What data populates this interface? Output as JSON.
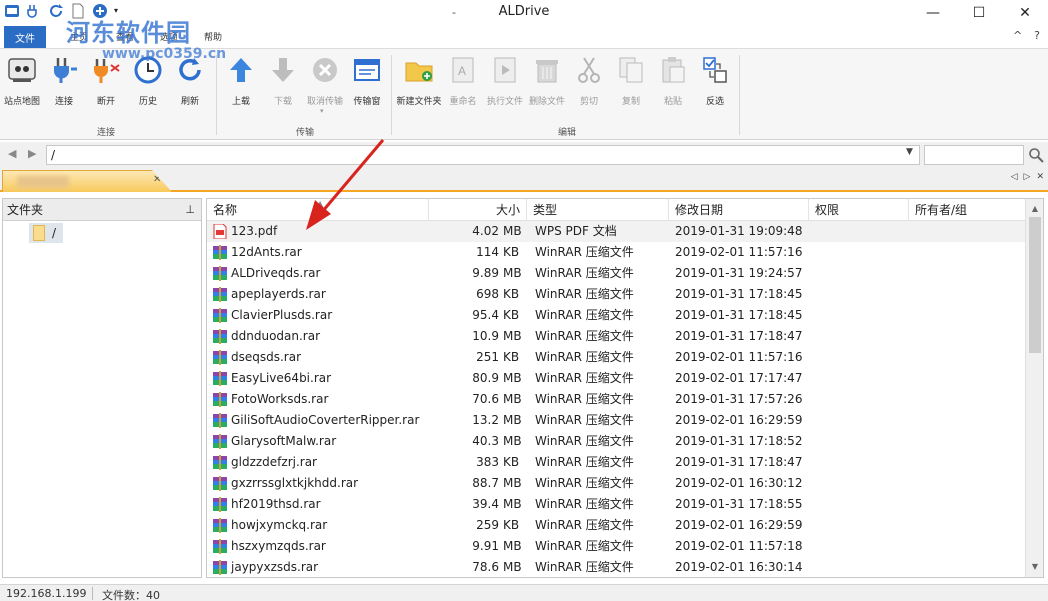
{
  "window": {
    "title": "ALDrive",
    "title_dash": "-",
    "minimize_glyph": "—",
    "maximize_glyph": "☐",
    "close_glyph": "✕"
  },
  "watermark": {
    "text": "河东软件园",
    "url": "www.pc0359.cn"
  },
  "menu": {
    "file_tab": "文件",
    "tabs": [
      "主页",
      "查看",
      "选项",
      "帮助"
    ],
    "help_glyph": "?",
    "collapse_glyph": "^"
  },
  "ribbon": {
    "groups": [
      {
        "label": "连接",
        "buttons": [
          {
            "label": "站点地图",
            "icon": "sitemap-icon",
            "enabled": true
          },
          {
            "label": "连接",
            "icon": "plug-icon",
            "enabled": true
          },
          {
            "label": "断开",
            "icon": "unplug-icon",
            "enabled": true
          },
          {
            "label": "历史",
            "icon": "clock-icon",
            "enabled": true
          },
          {
            "label": "刷新",
            "icon": "refresh-icon",
            "enabled": true
          }
        ]
      },
      {
        "label": "传输",
        "buttons": [
          {
            "label": "上载",
            "icon": "upload-icon",
            "enabled": true
          },
          {
            "label": "下载",
            "icon": "download-icon",
            "enabled": false
          },
          {
            "label": "取消传输",
            "icon": "cancel-icon",
            "enabled": false
          },
          {
            "label": "传输窗",
            "icon": "transfer-window-icon",
            "enabled": true
          }
        ]
      },
      {
        "label": "编辑",
        "buttons": [
          {
            "label": "新建文件夹",
            "icon": "new-folder-icon",
            "enabled": true
          },
          {
            "label": "重命名",
            "icon": "rename-icon",
            "enabled": false
          },
          {
            "label": "执行文件",
            "icon": "execute-icon",
            "enabled": false
          },
          {
            "label": "删除文件",
            "icon": "delete-icon",
            "enabled": false
          },
          {
            "label": "剪切",
            "icon": "cut-icon",
            "enabled": false
          },
          {
            "label": "复制",
            "icon": "copy-icon",
            "enabled": false
          },
          {
            "label": "粘贴",
            "icon": "paste-icon",
            "enabled": false
          },
          {
            "label": "反选",
            "icon": "invert-selection-icon",
            "enabled": true
          }
        ]
      }
    ]
  },
  "address": {
    "path": "/",
    "back_glyph": "◀",
    "forward_glyph": "▶",
    "dropdown_glyph": "▼",
    "search_value": ""
  },
  "tabs": {
    "close_glyph": "✕",
    "prev_glyph": "◁",
    "next_glyph": "▷",
    "close_all_glyph": "✕"
  },
  "folder_pane": {
    "title": "文件夹",
    "pin_glyph": "⊥",
    "items": [
      {
        "label": "/"
      }
    ]
  },
  "file_list": {
    "columns": [
      "名称",
      "大小",
      "类型",
      "修改日期",
      "权限",
      "所有者/组"
    ],
    "sort_glyph": "▲",
    "rows": [
      {
        "name": "123.pdf",
        "size": "4.02",
        "unit": "MB",
        "type": "WPS PDF 文档",
        "date": "2019-01-31 19:09:48",
        "icon": "pdf-icon"
      },
      {
        "name": "12dAnts.rar",
        "size": "114",
        "unit": "KB",
        "type": "WinRAR 压缩文件",
        "date": "2019-02-01 11:57:16",
        "icon": "rar-icon"
      },
      {
        "name": "ALDriveqds.rar",
        "size": "9.89",
        "unit": "MB",
        "type": "WinRAR 压缩文件",
        "date": "2019-01-31 19:24:57",
        "icon": "rar-icon"
      },
      {
        "name": "apeplayerds.rar",
        "size": "698",
        "unit": "KB",
        "type": "WinRAR 压缩文件",
        "date": "2019-01-31 17:18:45",
        "icon": "rar-icon"
      },
      {
        "name": "ClavierPlusds.rar",
        "size": "95.4",
        "unit": "KB",
        "type": "WinRAR 压缩文件",
        "date": "2019-01-31 17:18:45",
        "icon": "rar-icon"
      },
      {
        "name": "ddnduodan.rar",
        "size": "10.9",
        "unit": "MB",
        "type": "WinRAR 压缩文件",
        "date": "2019-01-31 17:18:47",
        "icon": "rar-icon"
      },
      {
        "name": "dseqsds.rar",
        "size": "251",
        "unit": "KB",
        "type": "WinRAR 压缩文件",
        "date": "2019-02-01 11:57:16",
        "icon": "rar-icon"
      },
      {
        "name": "EasyLive64bi.rar",
        "size": "80.9",
        "unit": "MB",
        "type": "WinRAR 压缩文件",
        "date": "2019-02-01 17:17:47",
        "icon": "rar-icon"
      },
      {
        "name": "FotoWorksds.rar",
        "size": "70.6",
        "unit": "MB",
        "type": "WinRAR 压缩文件",
        "date": "2019-01-31 17:57:26",
        "icon": "rar-icon"
      },
      {
        "name": "GiliSoftAudioCoverterRipper.rar",
        "size": "13.2",
        "unit": "MB",
        "type": "WinRAR 压缩文件",
        "date": "2019-02-01 16:29:59",
        "icon": "rar-icon"
      },
      {
        "name": "GlarysoftMalw.rar",
        "size": "40.3",
        "unit": "MB",
        "type": "WinRAR 压缩文件",
        "date": "2019-01-31 17:18:52",
        "icon": "rar-icon"
      },
      {
        "name": "gldzzdefzrj.rar",
        "size": "383",
        "unit": "KB",
        "type": "WinRAR 压缩文件",
        "date": "2019-01-31 17:18:47",
        "icon": "rar-icon"
      },
      {
        "name": "gxzrrssglxtkjkhdd.rar",
        "size": "88.7",
        "unit": "MB",
        "type": "WinRAR 压缩文件",
        "date": "2019-02-01 16:30:12",
        "icon": "rar-icon"
      },
      {
        "name": "hf2019thsd.rar",
        "size": "39.4",
        "unit": "MB",
        "type": "WinRAR 压缩文件",
        "date": "2019-01-31 17:18:55",
        "icon": "rar-icon"
      },
      {
        "name": "howjxymckq.rar",
        "size": "259",
        "unit": "KB",
        "type": "WinRAR 压缩文件",
        "date": "2019-02-01 16:29:59",
        "icon": "rar-icon"
      },
      {
        "name": "hszxymzqds.rar",
        "size": "9.91",
        "unit": "MB",
        "type": "WinRAR 压缩文件",
        "date": "2019-02-01 11:57:18",
        "icon": "rar-icon"
      },
      {
        "name": "jaypyxzsds.rar",
        "size": "78.6",
        "unit": "MB",
        "type": "WinRAR 压缩文件",
        "date": "2019-02-01 16:30:14",
        "icon": "rar-icon"
      }
    ]
  },
  "status": {
    "ip": "192.168.1.199",
    "count": "文件数：40"
  },
  "colors": {
    "accent": "#2b6cc4",
    "tab_orange": "#f5a623",
    "arrow_red": "#d9231d"
  }
}
